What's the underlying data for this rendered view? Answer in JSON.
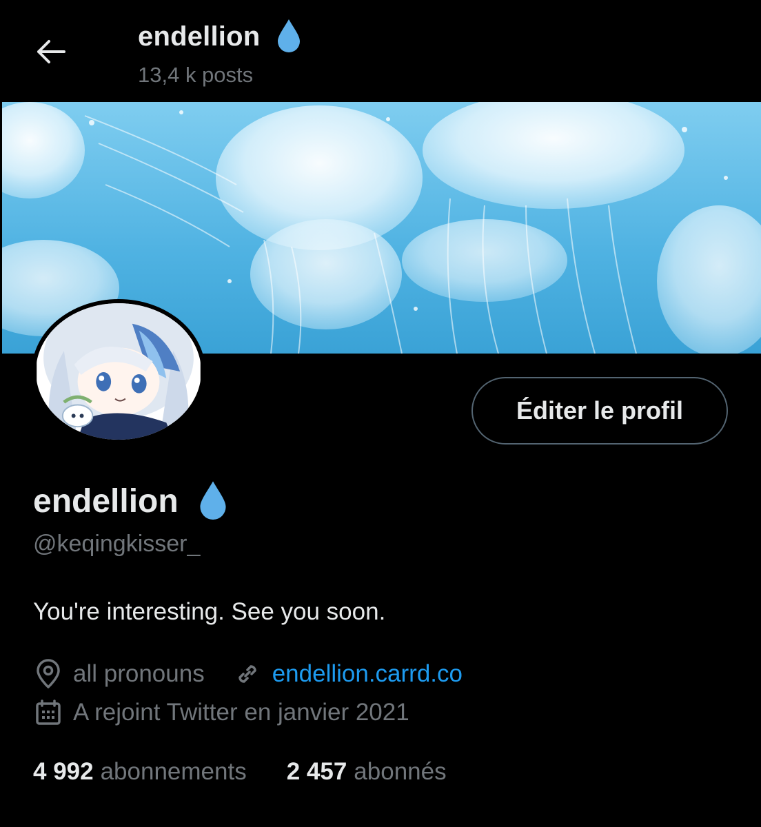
{
  "header": {
    "name": "endellion",
    "posts_count": "13,4 k posts"
  },
  "profile": {
    "display_name": "endellion",
    "handle": "@keqingkisser_",
    "bio": "You're interesting. See you soon.",
    "location": "all pronouns",
    "website": "endellion.carrd.co",
    "joined": "A rejoint Twitter en janvier 2021",
    "edit_button": "Éditer le profil"
  },
  "stats": {
    "following_count": "4 992",
    "following_label": "abonnements",
    "followers_count": "2 457",
    "followers_label": "abonnés"
  },
  "icons": {
    "back": "arrow-left-icon",
    "name_emoji": "droplet-icon",
    "location": "location-pin-icon",
    "link": "link-icon",
    "calendar": "calendar-icon"
  },
  "colors": {
    "background": "#000000",
    "primary_text": "#e7e9ea",
    "secondary_text": "#71767b",
    "link": "#1d9bf0",
    "droplet": "#5fb0ea",
    "banner_water": "#5bb8e4"
  }
}
